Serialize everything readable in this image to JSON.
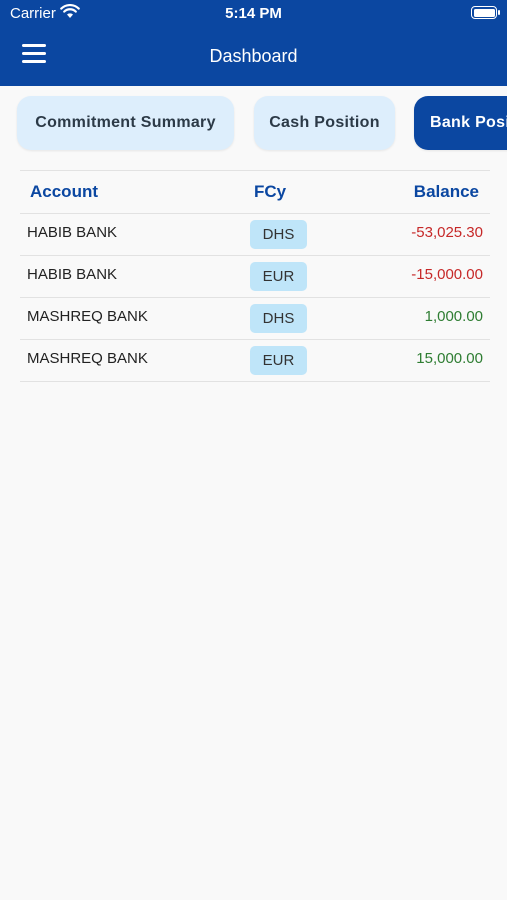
{
  "status_bar": {
    "carrier": "Carrier",
    "time": "5:14 PM"
  },
  "header": {
    "title": "Dashboard"
  },
  "tabs": [
    {
      "label": "Commitment Summary",
      "active": false
    },
    {
      "label": "Cash Position",
      "active": false
    },
    {
      "label": "Bank Position",
      "active": true
    }
  ],
  "table": {
    "columns": [
      "Account",
      "FCy",
      "Balance"
    ],
    "rows": [
      {
        "account": "HABIB BANK",
        "fcy": "DHS",
        "balance": "-53,025.30",
        "balance_color": "#c62828"
      },
      {
        "account": "HABIB BANK",
        "fcy": "EUR",
        "balance": "-15,000.00",
        "balance_color": "#c62828"
      },
      {
        "account": "MASHREQ BANK",
        "fcy": "DHS",
        "balance": "1,000.00",
        "balance_color": "#2e7d32"
      },
      {
        "account": "MASHREQ BANK",
        "fcy": "EUR",
        "balance": "15,000.00",
        "balance_color": "#2e7d32"
      }
    ]
  },
  "colors": {
    "primary": "#0b47a1",
    "tab_bg": "#ddeefc",
    "badge_bg": "#bfe5f9",
    "negative": "#c62828",
    "positive": "#2e7d32"
  },
  "icons": [
    "wifi-icon",
    "battery-icon",
    "menu-icon"
  ]
}
